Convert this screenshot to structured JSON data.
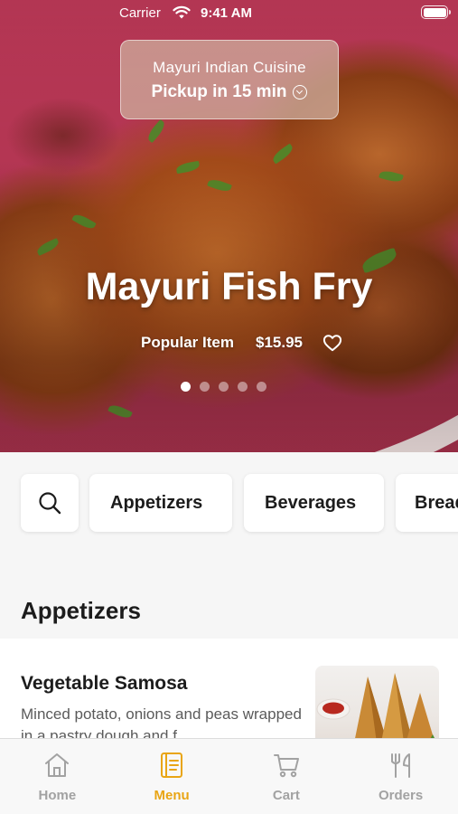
{
  "status_bar": {
    "carrier": "Carrier",
    "time": "9:41 AM"
  },
  "pickup": {
    "restaurant": "Mayuri Indian Cuisine",
    "eta": "Pickup in 15 min"
  },
  "featured": {
    "title": "Mayuri Fish Fry",
    "tag": "Popular Item",
    "price": "$15.95",
    "slides": 5,
    "active_slide": 1
  },
  "categories": [
    "Appetizers",
    "Beverages",
    "Breads"
  ],
  "section": {
    "title": "Appetizers"
  },
  "items": [
    {
      "name": "Vegetable Samosa",
      "description": "Minced potato, onions and peas wrapped in a pastry dough and f..."
    }
  ],
  "tabs": [
    {
      "label": "Home",
      "icon": "home-icon"
    },
    {
      "label": "Menu",
      "icon": "menu-book-icon"
    },
    {
      "label": "Cart",
      "icon": "cart-icon"
    },
    {
      "label": "Orders",
      "icon": "fork-knife-icon"
    }
  ],
  "active_tab": "Menu",
  "colors": {
    "accent": "#e9a514",
    "inactive": "#a2a2a2",
    "hero_bg": "#b8354f"
  }
}
